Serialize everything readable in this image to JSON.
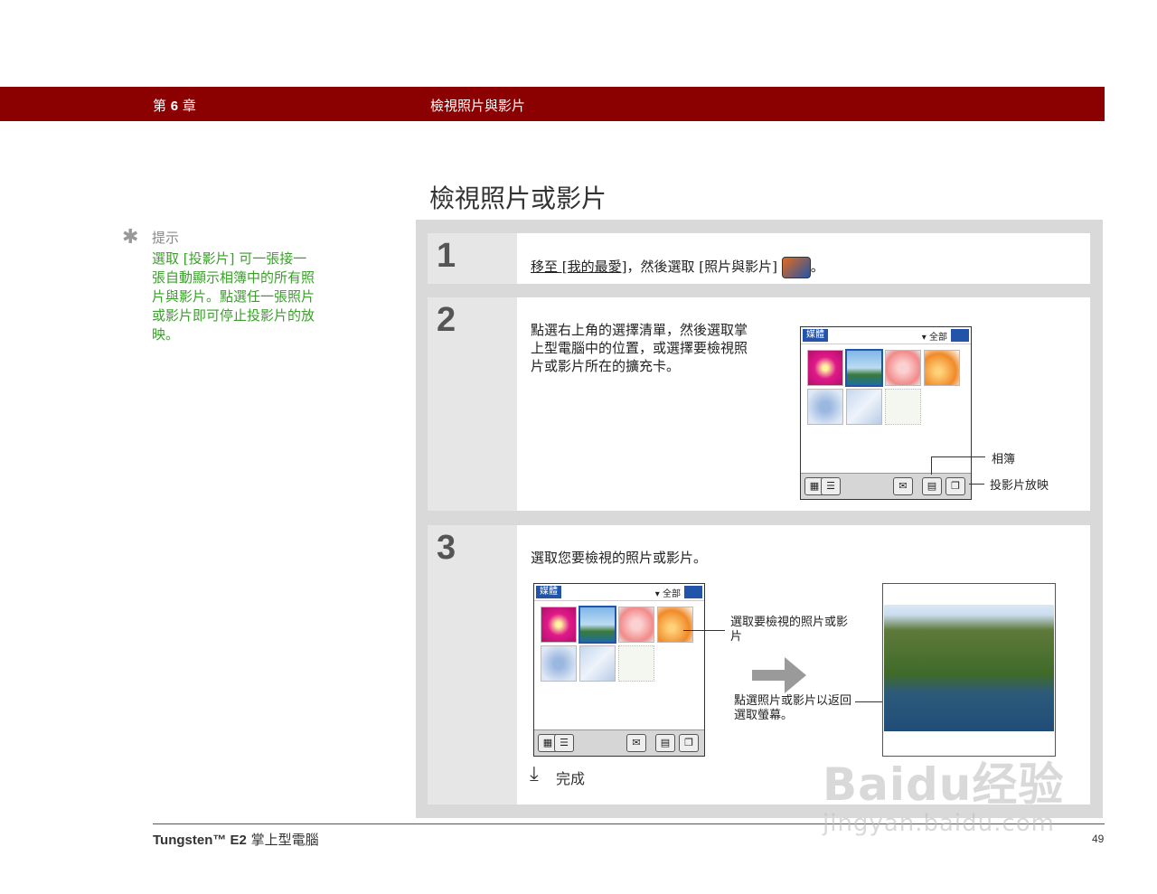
{
  "header": {
    "chapter_prefix": "第",
    "chapter_num": "6",
    "chapter_suffix": "章",
    "section": "檢視照片與影片"
  },
  "page_title": "檢視照片或影片",
  "tip": {
    "label": "提示",
    "text": "選取 [投影片] 可一張接一張自動顯示相簿中的所有照片與影片。點選任一張照片或影片即可停止投影片的放映。"
  },
  "steps": [
    {
      "number": "1",
      "link_text": "移至 [我的最愛]",
      "text": "，然後選取 [照片與影片]",
      "end": "。"
    },
    {
      "number": "2",
      "text": "點選右上角的選擇清單，然後選取掌上型電腦中的位置，或選擇要檢視照片或影片所在的擴充卡。",
      "callouts": [
        "相簿",
        "投影片放映"
      ]
    },
    {
      "number": "3",
      "text": "選取您要檢視的照片或影片。",
      "callouts": [
        "選取要檢視的照片或影片",
        "點選照片或影片以返回選取螢幕。"
      ],
      "done_label": "完成"
    }
  ],
  "device": {
    "tab_label": "媒體",
    "dropdown_label": "▾ 全部"
  },
  "footer": {
    "product": "Tungsten™ E2",
    "product_suffix": " 掌上型電腦",
    "page_number": "49"
  },
  "watermark": {
    "main": "Baidu经验",
    "url": "jingyan.baidu.com"
  }
}
